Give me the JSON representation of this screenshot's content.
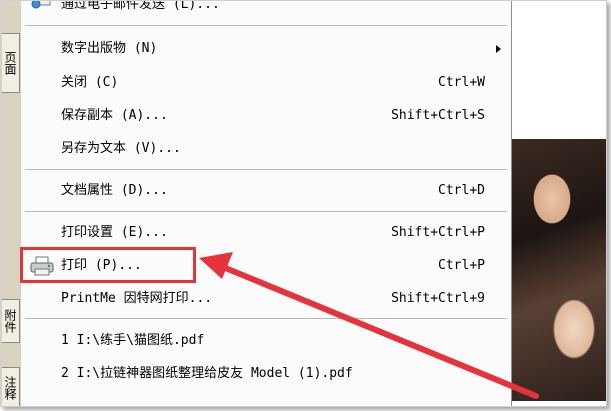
{
  "menu": {
    "items": [
      {
        "label": "通过电子邮件发送 (L)...",
        "shortcut": ""
      },
      {
        "label": "数字出版物 (N)",
        "shortcut": ""
      },
      {
        "label": "关闭 (C)",
        "shortcut": "Ctrl+W"
      },
      {
        "label": "保存副本 (A)...",
        "shortcut": "Shift+Ctrl+S"
      },
      {
        "label": "另存为文本 (V)...",
        "shortcut": ""
      },
      {
        "label": "文档属性 (D)...",
        "shortcut": "Ctrl+D"
      },
      {
        "label": "打印设置 (E)...",
        "shortcut": "Shift+Ctrl+P"
      },
      {
        "label": "打印 (P)...",
        "shortcut": "Ctrl+P"
      },
      {
        "label": "PrintMe 因特网打印...",
        "shortcut": "Shift+Ctrl+9"
      },
      {
        "label": "1 I:\\练手\\猫图纸.pdf",
        "shortcut": ""
      },
      {
        "label": "2 I:\\拉链神器图纸整理给皮友 Model (1).pdf",
        "shortcut": ""
      }
    ]
  },
  "side_tabs": {
    "pages": "页面",
    "attachments": "附件",
    "comments": "注释"
  },
  "icons": {
    "mail": "mail-icon",
    "printer": "printer-icon",
    "submenu": "chevron-right-icon"
  },
  "colors": {
    "annotation": "#e5333b"
  }
}
